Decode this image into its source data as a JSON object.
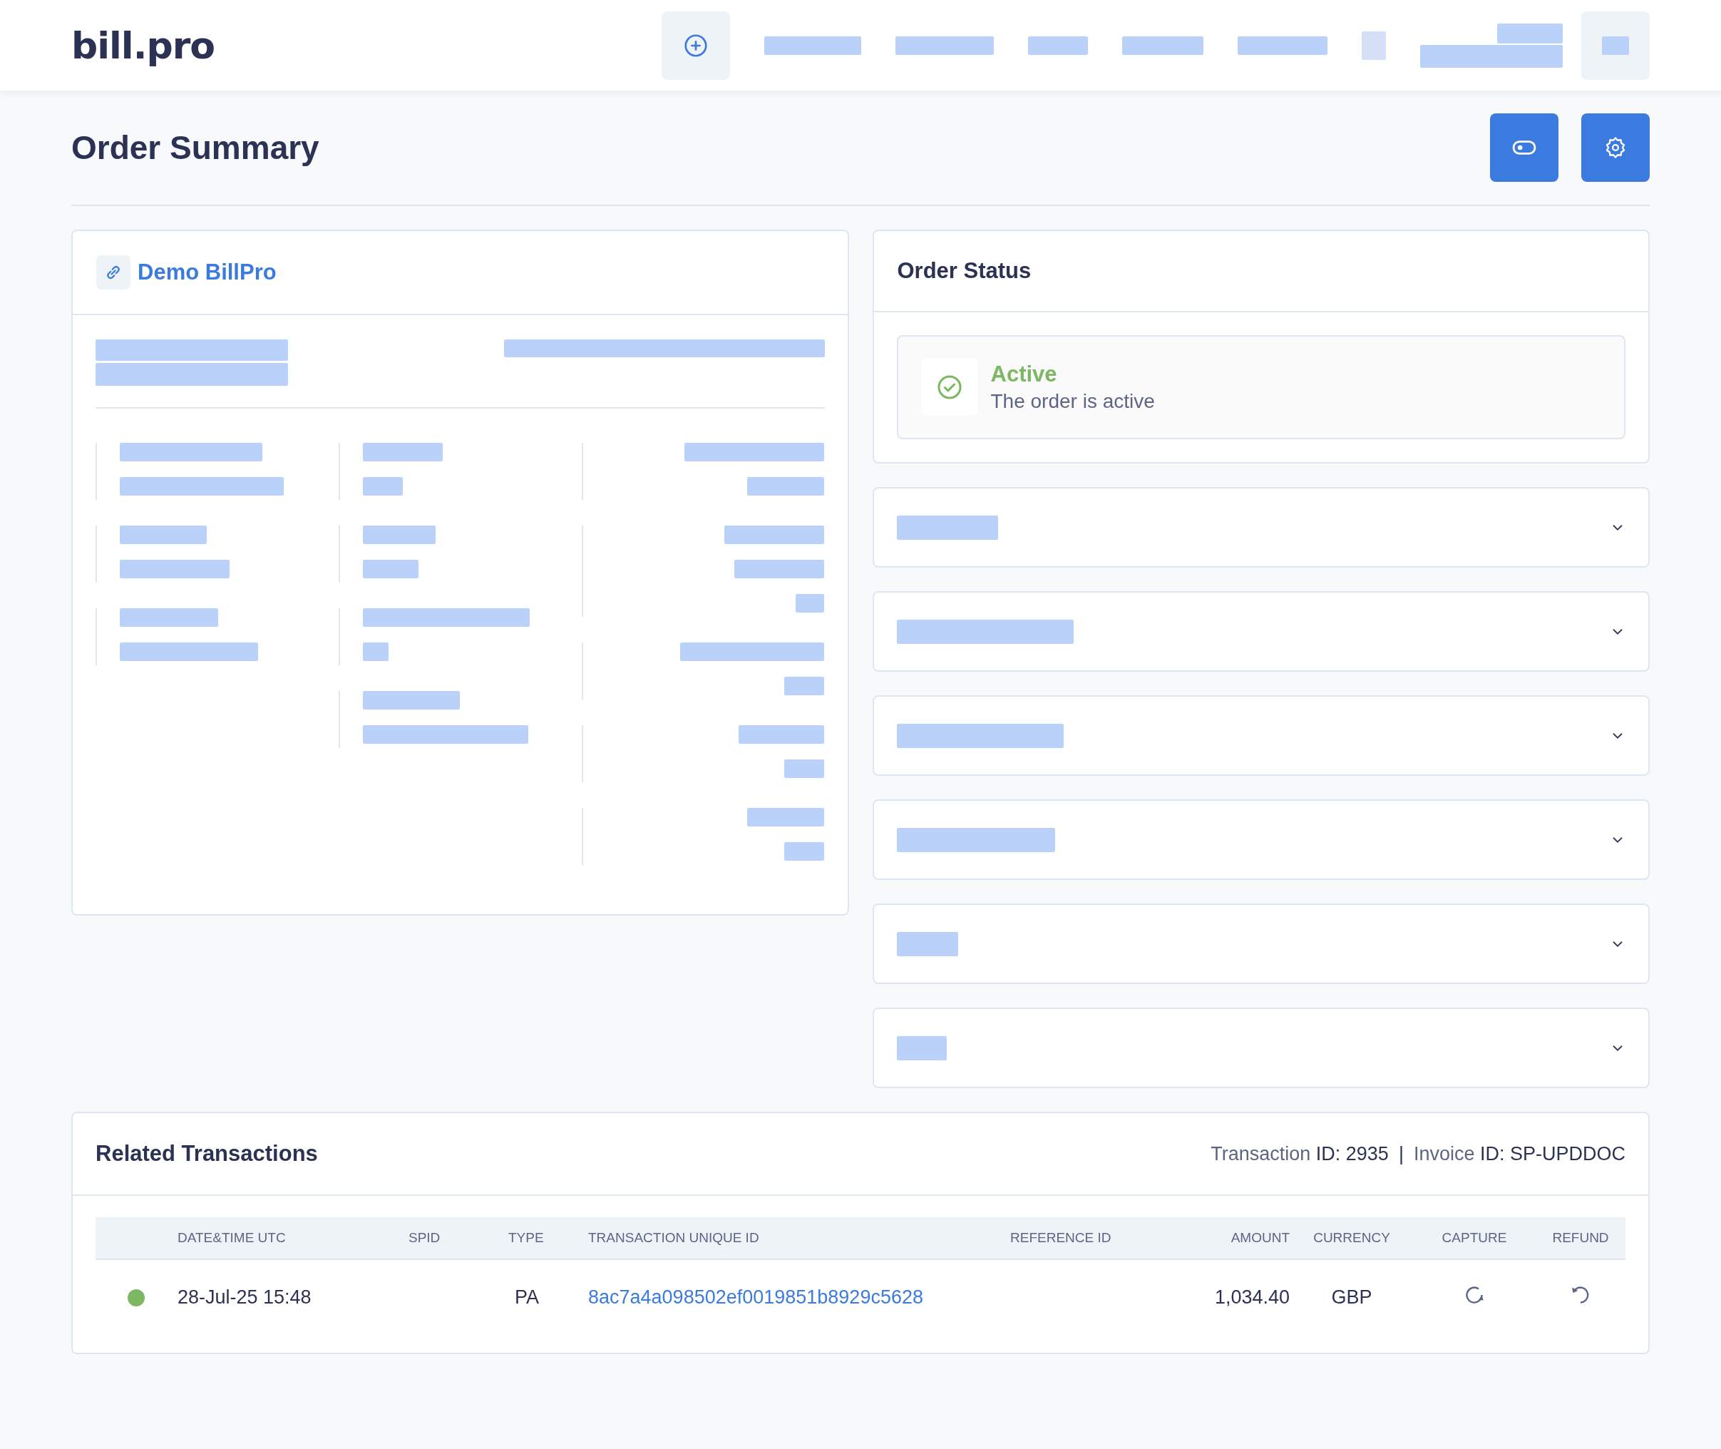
{
  "header": {
    "logo": "bill.pro"
  },
  "page": {
    "title": "Order Summary"
  },
  "merchant_card": {
    "title": "Demo BillPro"
  },
  "order_status": {
    "title": "Order Status",
    "status": {
      "label": "Active",
      "description": "The order is active",
      "color": "#7cb863"
    }
  },
  "accordions": [
    {
      "expanded": false
    },
    {
      "expanded": false
    },
    {
      "expanded": false
    },
    {
      "expanded": false
    },
    {
      "expanded": false
    },
    {
      "expanded": false
    }
  ],
  "transactions": {
    "title": "Related Transactions",
    "transaction_id": {
      "label": "Transaction",
      "value": "ID: 2935"
    },
    "separator": "|",
    "invoice_id": {
      "label": "Invoice",
      "value": "ID: SP-UPDDOC"
    },
    "columns": [
      "",
      "DATE&TIME UTC",
      "SPID",
      "TYPE",
      "TRANSACTION UNIQUE ID",
      "REFERENCE ID",
      "AMOUNT",
      "CURRENCY",
      "CAPTURE",
      "REFUND"
    ],
    "rows": [
      {
        "color": "#7cb863",
        "datetime": "28-Jul-25 15:48",
        "spid": "",
        "type": "PA",
        "unique_id": "8ac7a4a098502ef0019851b8929c5628",
        "reference_id": "",
        "amount": "1,034.40",
        "currency": "GBP"
      }
    ]
  }
}
